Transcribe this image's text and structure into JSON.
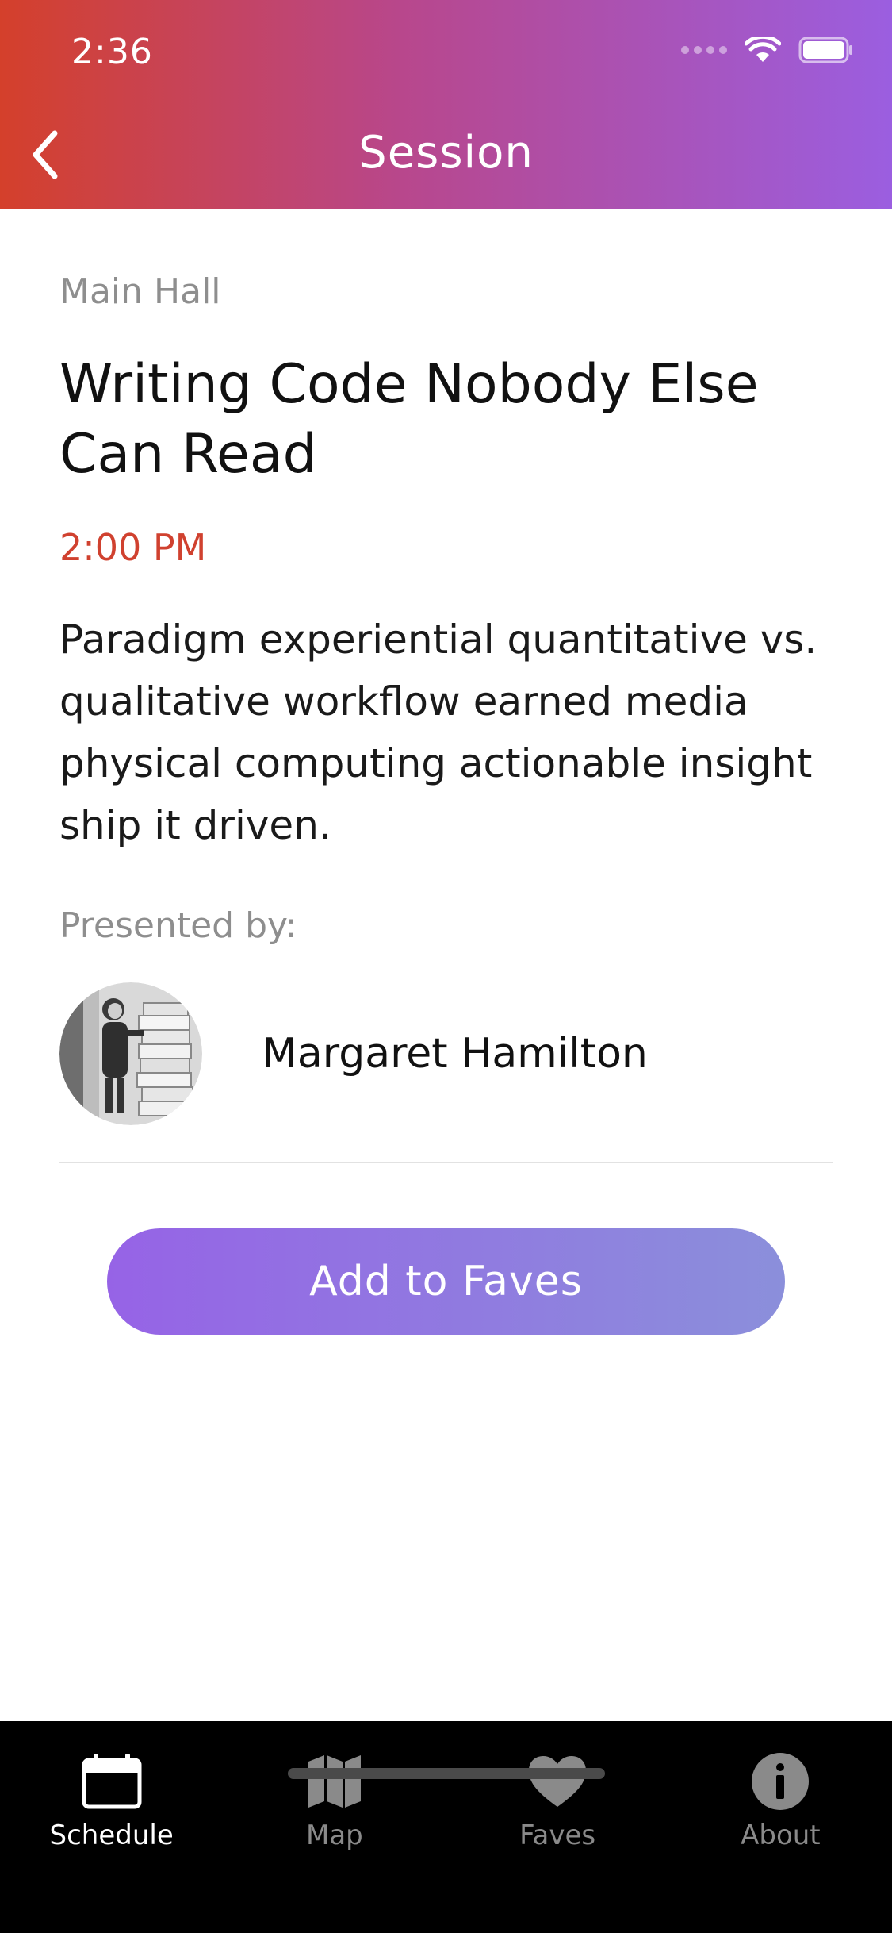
{
  "status_bar": {
    "time": "2:36"
  },
  "nav": {
    "title": "Session",
    "back_icon": "chevron-left-icon"
  },
  "session": {
    "room": "Main Hall",
    "title": "Writing Code Nobody Else Can Read",
    "time": "2:00 PM",
    "description": "Paradigm experiential quantitative vs. qualitative workflow earned media physical computing actionable insight ship it driven.",
    "presented_by_label": "Presented by:",
    "speaker": {
      "name": "Margaret Hamilton"
    }
  },
  "actions": {
    "add_to_faves": "Add to Faves"
  },
  "tab_bar": {
    "tabs": [
      {
        "label": "Schedule",
        "icon": "calendar-icon",
        "active": true
      },
      {
        "label": "Map",
        "icon": "map-icon",
        "active": false
      },
      {
        "label": "Faves",
        "icon": "heart-icon",
        "active": false
      },
      {
        "label": "About",
        "icon": "info-icon",
        "active": false
      }
    ]
  },
  "colors": {
    "header_gradient_start": "#d4402b",
    "header_gradient_end": "#9b5ee0",
    "time_accent": "#d0412f",
    "button_gradient_start": "#9663e6",
    "button_gradient_end": "#8b8fdb",
    "tab_bar_bg": "#000000"
  }
}
